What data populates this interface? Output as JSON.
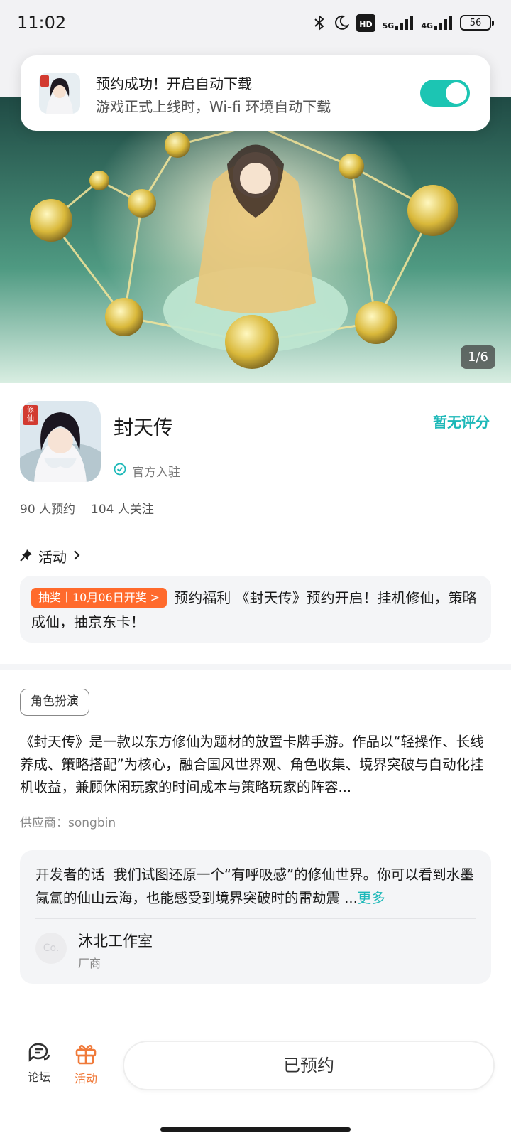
{
  "status_bar": {
    "time": "11:02",
    "network_5g": "5G",
    "network_4g": "4G",
    "hd_badge": "HD",
    "battery": "56"
  },
  "toast": {
    "title": "预约成功！开启自动下载",
    "subtitle": "游戏正式上线时，Wi-fi 环境自动下载",
    "toggle_on": true,
    "accent": "#1cc5b3"
  },
  "hero": {
    "counter": "1/6"
  },
  "game": {
    "title": "封天传",
    "rating_text": "暂无评分",
    "official_label": "官方入驻",
    "reservations": "90 人预约",
    "followers": "104 人关注",
    "icon_badge": "修仙"
  },
  "activity": {
    "heading": "活动",
    "tag": "抽奖丨10月06日开奖 >",
    "text": "预约福利 《封天传》预约开启！挂机修仙，策略成仙，抽京东卡！"
  },
  "genre": "角色扮演",
  "description": "《封天传》是一款以东方修仙为题材的放置卡牌手游。作品以“轻操作、长线养成、策略搭配”为核心，融合国风世界观、角色收集、境界突破与自动化挂机收益，兼顾休闲玩家的时间成本与策略玩家的阵容...",
  "supplier": "供应商：songbin",
  "developer": {
    "label": "开发者的话",
    "text": "我们试图还原一个“有呼吸感”的修仙世界。你可以看到水墨氤氲的仙山云海，也能感受到境界突破时的雷劫震 ...",
    "more": "更多",
    "avatar_text": "Co.",
    "studio": "沐北工作室",
    "role": "厂商"
  },
  "bottom_bar": {
    "forum": "论坛",
    "activity": "活动",
    "reserved_button": "已预约"
  }
}
